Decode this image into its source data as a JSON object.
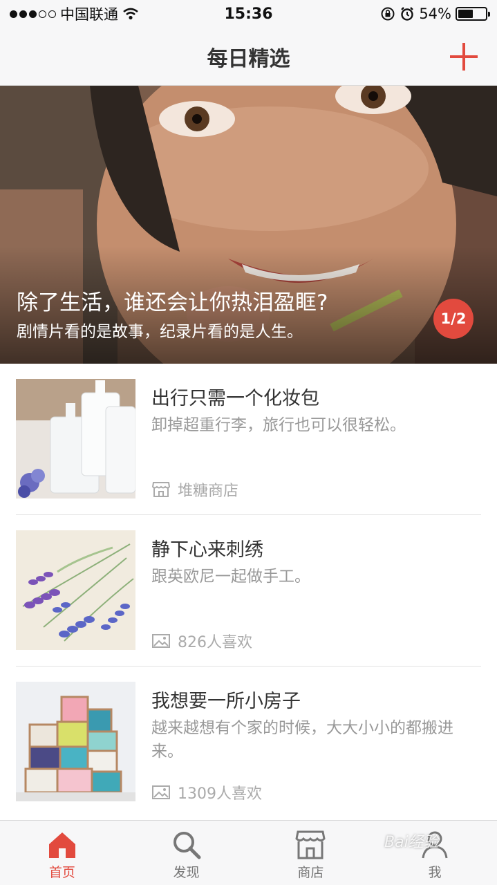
{
  "status_bar": {
    "carrier": "中国联通",
    "time": "15:36",
    "battery_percent": "54%",
    "battery_level": 0.54,
    "signal_bars_filled": 3,
    "signal_bars_total": 5
  },
  "nav": {
    "title": "每日精选",
    "add_icon": "plus-icon"
  },
  "banner": {
    "title": "除了生活，谁还会让你热泪盈眶?",
    "subtitle": "剧情片看的是故事，纪录片看的是人生。",
    "pager": "1/2"
  },
  "feed": {
    "items": [
      {
        "title": "出行只需一个化妆包",
        "description": "卸掉超重行李，旅行也可以很轻松。",
        "meta_icon": "store-icon",
        "meta": "堆糖商店"
      },
      {
        "title": "静下心来刺绣",
        "description": "跟英欧尼一起做手工。",
        "meta_icon": "image-icon",
        "meta": "826人喜欢"
      },
      {
        "title": "我想要一所小房子",
        "description": "越来越想有个家的时候，大大小小的都搬进来。",
        "meta_icon": "image-icon",
        "meta": "1309人喜欢"
      }
    ]
  },
  "tabs": [
    {
      "label": "首页",
      "icon": "home-icon",
      "active": true
    },
    {
      "label": "发现",
      "icon": "search-icon",
      "active": false
    },
    {
      "label": "商店",
      "icon": "store-icon",
      "active": false
    },
    {
      "label": "我",
      "icon": "user-icon",
      "active": false
    }
  ],
  "watermark": "Bai经验",
  "colors": {
    "accent": "#e24a3e",
    "bar_bg": "#f7f7f8",
    "text_muted": "#999999"
  }
}
